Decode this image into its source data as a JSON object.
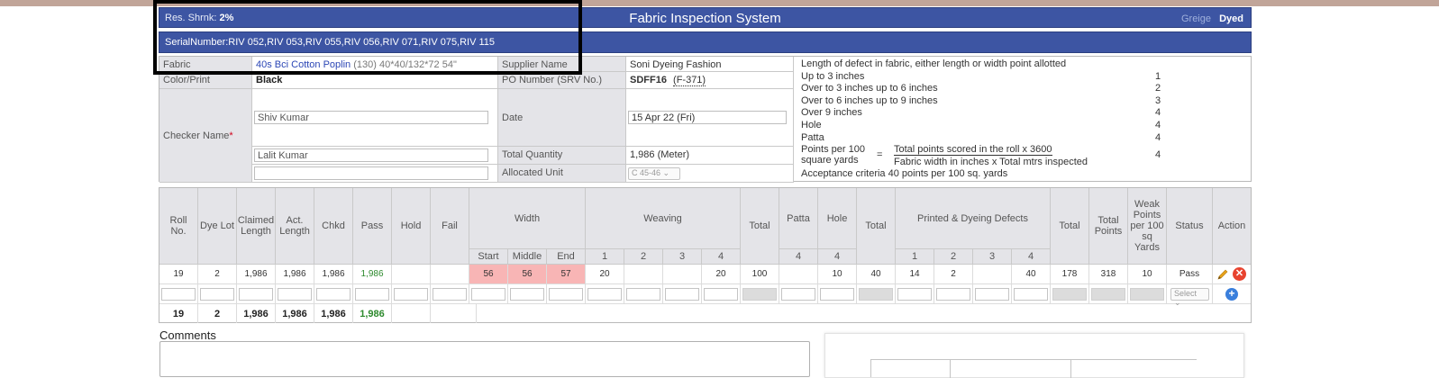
{
  "header": {
    "shrink_label": "Res. Shrnk:",
    "shrink_value": "2%",
    "title": "Fabric Inspection System",
    "greige_label": "Greige",
    "dyed_label": "Dyed"
  },
  "serial": {
    "text": "SerialNumber:RIV 052,RIV 053,RIV 055,RIV 056,RIV 071,RIV 075,RIV 115"
  },
  "info": {
    "fabric_label": "Fabric",
    "fabric_name": "40s Bci Cotton Poplin",
    "fabric_details": "(130) 40*40/132*72 54\"",
    "supplier_label": "Supplier Name",
    "supplier_value": "Soni Dyeing Fashion",
    "color_label": "Color/Print",
    "color_value": "Black",
    "po_label": "PO Number (SRV No.)",
    "po_value": "SDFF16",
    "po_ref": "(F-371)",
    "checker_label": "Checker Name",
    "checker_required": "*",
    "checker_1": "Shiv Kumar",
    "checker_2": "Lalit Kumar",
    "date_label": "Date",
    "date_value": "15 Apr 22 (Fri)",
    "qty_label": "Total Quantity",
    "qty_value": "1,986 (Meter)",
    "unit_label": "Allocated Unit",
    "unit_value": "C 45-46"
  },
  "legend": {
    "heading": "Length of defect in fabric, either length or width point allotted",
    "rows": [
      {
        "label": "Up to 3 inches",
        "points": "1"
      },
      {
        "label": "Over to 3 inches up to 6 inches",
        "points": "2"
      },
      {
        "label": "Over to 6 inches up to 9 inches",
        "points": "3"
      },
      {
        "label": "Over 9 inches",
        "points": "4"
      },
      {
        "label": "Hole",
        "points": "4"
      },
      {
        "label": "Patta",
        "points": "4"
      }
    ],
    "formula_label_1": "Points per 100",
    "formula_label_2": "square yards",
    "formula_eq": "=",
    "formula_num": "Total points scored in the roll x 3600",
    "formula_den": "Fabric width in inches x Total mtrs inspected",
    "formula_points": "4",
    "acceptance": "Acceptance criteria 40 points per 100 sq. yards"
  },
  "grid": {
    "headers": {
      "roll": "Roll No.",
      "dye_lot": "Dye Lot",
      "claimed": "Claimed Length",
      "act": "Act. Length",
      "chkd": "Chkd",
      "pass": "Pass",
      "hold": "Hold",
      "fail": "Fail",
      "width": "Width",
      "weaving": "Weaving",
      "total1": "Total",
      "patta": "Patta",
      "hole": "Hole",
      "total2": "Total",
      "printed": "Printed & Dyeing Defects",
      "total3": "Total",
      "total_points": "Total Points",
      "weak": "Weak Points per 100 sq Yards",
      "status": "Status",
      "action": "Action"
    },
    "sub": {
      "start": "Start",
      "middle": "Middle",
      "end": "End",
      "w1": "1",
      "w2": "2",
      "w3": "3",
      "w4": "4",
      "patta4": "4",
      "hole4": "4",
      "p1": "1",
      "p2": "2",
      "p3": "3",
      "p4": "4"
    },
    "row": {
      "roll": "19",
      "dye_lot": "2",
      "claimed": "1,986",
      "act": "1,986",
      "chkd": "1,986",
      "pass": "1,986",
      "hold": "",
      "fail": "",
      "w_start": "56",
      "w_middle": "56",
      "w_end": "57",
      "wv1": "20",
      "wv2": "",
      "wv3": "",
      "wv4": "20",
      "total1": "100",
      "patta": "",
      "hole": "10",
      "total2": "40",
      "pd1": "14",
      "pd2": "2",
      "pd3": "",
      "pd4": "40",
      "total3": "178",
      "total_points": "318",
      "weak": "10",
      "status": "Pass"
    },
    "status_select_placeholder": "Select",
    "totals": {
      "roll": "19",
      "dye_lot": "2",
      "claimed": "1,986",
      "act": "1,986",
      "chkd": "1,986",
      "pass": "1,986"
    }
  },
  "comments": {
    "label": "Comments"
  },
  "colors": {
    "header_bg": "#3d55a3",
    "pink": "#f8b5b5",
    "delete": "#e8432f",
    "add": "#3a7fdc",
    "pass_green": "#2d8a2d"
  },
  "icons": {
    "edit": "pencil-icon",
    "delete": "delete-icon",
    "add": "add-icon"
  }
}
